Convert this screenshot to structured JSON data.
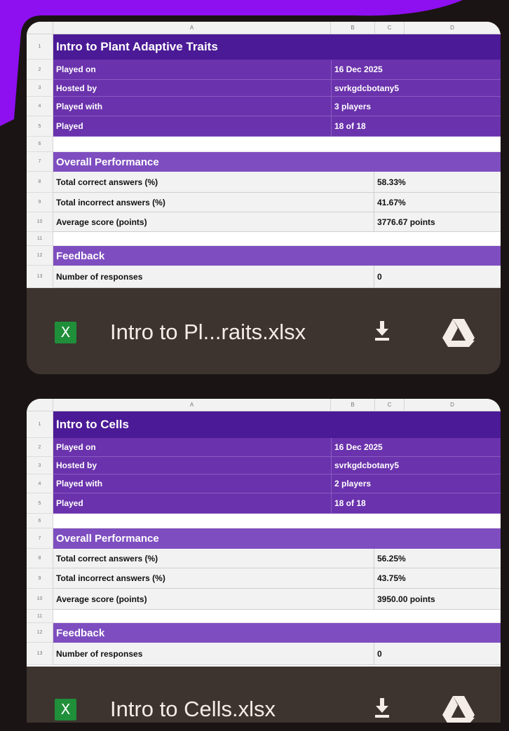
{
  "col_headers": [
    "A",
    "B",
    "C",
    "D"
  ],
  "row_numbers": [
    "1",
    "2",
    "3",
    "4",
    "5",
    "6",
    "7",
    "8",
    "9",
    "10",
    "11",
    "12",
    "13"
  ],
  "sheets": [
    {
      "title": "Intro to Plant Adaptive Traits",
      "info": [
        {
          "label": "Played on",
          "value": "16 Dec 2025"
        },
        {
          "label": "Hosted by",
          "value": "svrkgdcbotany5"
        },
        {
          "label": "Played with",
          "value": "3 players"
        },
        {
          "label": "Played",
          "value": "18 of 18"
        }
      ],
      "performance_heading": "Overall Performance",
      "performance": [
        {
          "label": "Total correct answers (%)",
          "value": "58.33%"
        },
        {
          "label": "Total incorrect answers (%)",
          "value": "41.67%"
        },
        {
          "label": "Average score (points)",
          "value": "3776.67 points"
        }
      ],
      "feedback_heading": "Feedback",
      "feedback": [
        {
          "label": "Number of responses",
          "value": "0"
        }
      ],
      "file_name": "Intro to Pl...raits.xlsx",
      "file_icon": "X"
    },
    {
      "title": "Intro to Cells",
      "info": [
        {
          "label": "Played on",
          "value": "16 Dec 2025"
        },
        {
          "label": "Hosted by",
          "value": "svrkgdcbotany5"
        },
        {
          "label": "Played with",
          "value": "2 players"
        },
        {
          "label": "Played",
          "value": "18 of 18"
        }
      ],
      "performance_heading": "Overall Performance",
      "performance": [
        {
          "label": "Total correct answers (%)",
          "value": "56.25%"
        },
        {
          "label": "Total incorrect answers (%)",
          "value": "43.75%"
        },
        {
          "label": "Average score (points)",
          "value": "3950.00 points"
        }
      ],
      "feedback_heading": "Feedback",
      "feedback": [
        {
          "label": "Number of responses",
          "value": "0"
        }
      ],
      "file_name": "Intro to Cells.xlsx",
      "file_icon": "X"
    }
  ],
  "icons": {
    "file_type": "excel-icon",
    "download": "download-icon",
    "drive": "google-drive-icon"
  },
  "colors": {
    "background": "#1b1414",
    "corner_accent": "#8e0ff0",
    "card": "#3d342f",
    "title_row": "#4b1a96",
    "info_row": "#6a32ac",
    "section_row": "#7e4ec0",
    "excel_green": "#1f8f3a"
  }
}
